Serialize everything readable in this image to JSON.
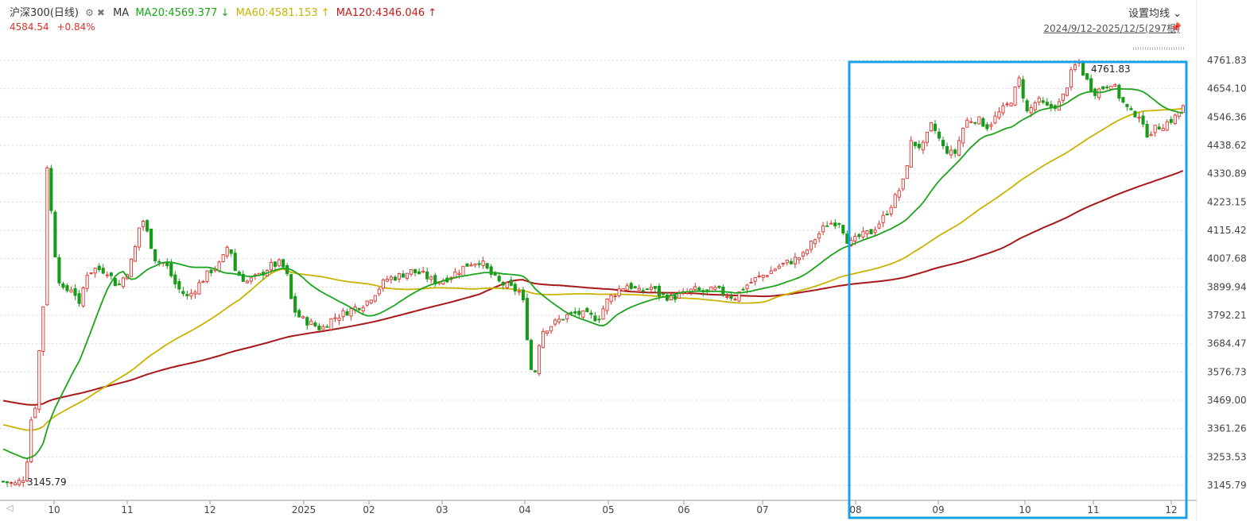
{
  "header": {
    "title": "沪深300(日线)",
    "ma_label": "MA",
    "ma20": "MA20:4569.377 ↓",
    "ma60": "MA60:4581.153 ↑",
    "ma120": "MA120:4346.046 ↑",
    "price": "4584.54",
    "change": "+0.84%",
    "settings": "设置均线",
    "range": "2024/9/12-2025/12/5(297根)",
    "gear_icon": "gear-icon",
    "close_icon": "close-icon"
  },
  "chart_data": {
    "type": "candlestick",
    "yticks": [
      4761.83,
      4654.1,
      4546.36,
      4438.62,
      4330.89,
      4223.15,
      4115.42,
      4007.68,
      3899.94,
      3792.21,
      3684.47,
      3576.73,
      3469.0,
      3361.26,
      3253.53,
      3145.79
    ],
    "ylim": [
      3115,
      4810
    ],
    "xticks": [
      "10",
      "11",
      "12",
      "2025",
      "02",
      "03",
      "04",
      "05",
      "06",
      "07",
      "08",
      "09",
      "10",
      "11",
      "12"
    ],
    "annotations": [
      {
        "text": "4761.83",
        "value": 4761.83
      },
      {
        "text": "3145.79",
        "value": 3145.79
      }
    ],
    "colors": {
      "up": "#e0302a",
      "down": "#1a9a1a",
      "ma20": "#1aa51a",
      "ma60": "#c9b300",
      "ma120": "#a81818",
      "highlight": "#1aa0e6"
    }
  }
}
